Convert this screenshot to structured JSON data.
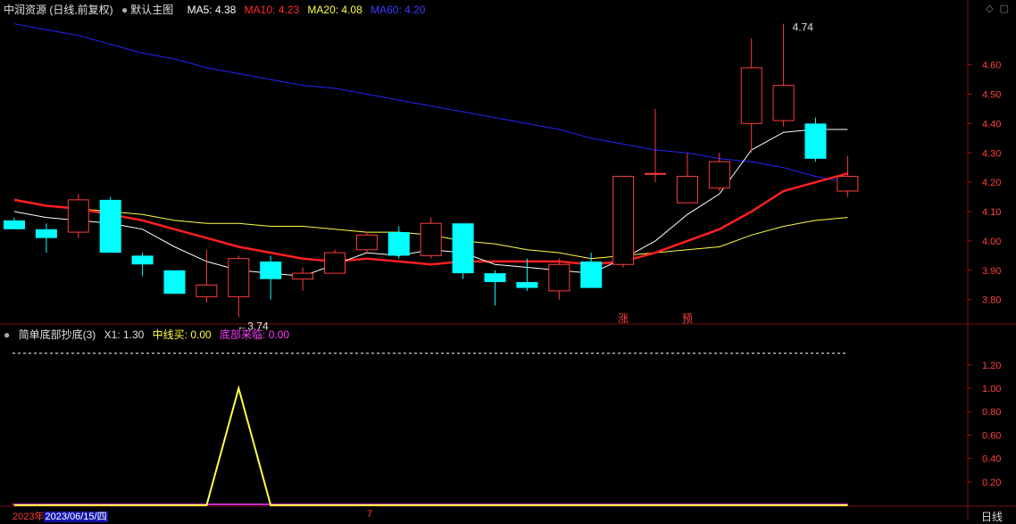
{
  "header": {
    "stock": "中润资源 (日线,前复权)",
    "template": "默认主图",
    "ma5": "MA5: 4.38",
    "ma10": "MA10: 4.23",
    "ma20": "MA20: 4.08",
    "ma60": "MA60: 4.20"
  },
  "indicator_header": {
    "name": "简单底部抄底(3)",
    "x1": "X1: 1.30",
    "zhongxian": "中线买: 0.00",
    "dibu": "底部来临: 0.00"
  },
  "footer": {
    "year": "2023年",
    "date": "2023/06/15/四",
    "mark": "7",
    "period": "日线"
  },
  "colors": {
    "up": "#ff3c3c",
    "down": "#00ffff",
    "ma5": "#ffffff",
    "ma10": "#ff2020",
    "ma20": "#ffff44",
    "ma60": "#2424ff"
  },
  "chart_data": [
    {
      "type": "candlestick",
      "yticks": [
        3.8,
        3.9,
        4.0,
        4.1,
        4.2,
        4.3,
        4.4,
        4.5,
        4.6
      ],
      "ylim": [
        3.72,
        4.76
      ],
      "candles": [
        {
          "o": 4.07,
          "h": 4.08,
          "l": 4.04,
          "c": 4.04
        },
        {
          "o": 4.04,
          "h": 4.06,
          "l": 3.96,
          "c": 4.01
        },
        {
          "o": 4.03,
          "h": 4.16,
          "l": 4.01,
          "c": 4.14
        },
        {
          "o": 4.14,
          "h": 4.15,
          "l": 3.96,
          "c": 3.96
        },
        {
          "o": 3.95,
          "h": 3.96,
          "l": 3.88,
          "c": 3.92
        },
        {
          "o": 3.9,
          "h": 3.9,
          "l": 3.82,
          "c": 3.82
        },
        {
          "o": 3.81,
          "h": 3.97,
          "l": 3.79,
          "c": 3.85
        },
        {
          "o": 3.81,
          "h": 3.95,
          "l": 3.74,
          "c": 3.94
        },
        {
          "o": 3.93,
          "h": 3.95,
          "l": 3.8,
          "c": 3.87
        },
        {
          "o": 3.87,
          "h": 3.91,
          "l": 3.83,
          "c": 3.89
        },
        {
          "o": 3.89,
          "h": 3.97,
          "l": 3.89,
          "c": 3.96
        },
        {
          "o": 3.97,
          "h": 4.03,
          "l": 3.96,
          "c": 4.02
        },
        {
          "o": 4.03,
          "h": 4.05,
          "l": 3.94,
          "c": 3.95
        },
        {
          "o": 3.95,
          "h": 4.08,
          "l": 3.94,
          "c": 4.06
        },
        {
          "o": 4.06,
          "h": 4.06,
          "l": 3.87,
          "c": 3.89
        },
        {
          "o": 3.89,
          "h": 3.9,
          "l": 3.78,
          "c": 3.86
        },
        {
          "o": 3.86,
          "h": 3.94,
          "l": 3.83,
          "c": 3.84
        },
        {
          "o": 3.83,
          "h": 3.94,
          "l": 3.8,
          "c": 3.92
        },
        {
          "o": 3.93,
          "h": 3.96,
          "l": 3.84,
          "c": 3.84
        },
        {
          "o": 3.92,
          "h": 4.22,
          "l": 3.91,
          "c": 4.22
        },
        {
          "o": 4.23,
          "h": 4.45,
          "l": 4.2,
          "c": 4.23
        },
        {
          "o": 4.13,
          "h": 4.3,
          "l": 4.13,
          "c": 4.22
        },
        {
          "o": 4.18,
          "h": 4.3,
          "l": 4.17,
          "c": 4.27
        },
        {
          "o": 4.4,
          "h": 4.69,
          "l": 4.3,
          "c": 4.59
        },
        {
          "o": 4.41,
          "h": 4.74,
          "l": 4.39,
          "c": 4.53
        },
        {
          "o": 4.4,
          "h": 4.42,
          "l": 4.27,
          "c": 4.28
        },
        {
          "o": 4.17,
          "h": 4.29,
          "l": 4.15,
          "c": 4.22
        }
      ],
      "ma5": [
        4.1,
        4.08,
        4.07,
        4.06,
        4.04,
        3.98,
        3.93,
        3.9,
        3.89,
        3.88,
        3.92,
        3.96,
        3.95,
        3.97,
        3.96,
        3.92,
        3.91,
        3.9,
        3.89,
        3.94,
        4.0,
        4.09,
        4.16,
        4.31,
        4.37,
        4.38,
        4.38
      ],
      "ma10": [
        4.14,
        4.12,
        4.11,
        4.09,
        4.07,
        4.04,
        4.01,
        3.98,
        3.96,
        3.94,
        3.93,
        3.94,
        3.93,
        3.92,
        3.93,
        3.93,
        3.93,
        3.93,
        3.92,
        3.93,
        3.96,
        4.0,
        4.04,
        4.1,
        4.17,
        4.2,
        4.23
      ],
      "ma20": [
        4.14,
        4.12,
        4.11,
        4.1,
        4.09,
        4.07,
        4.06,
        4.06,
        4.05,
        4.05,
        4.04,
        4.03,
        4.03,
        4.02,
        4.0,
        3.99,
        3.97,
        3.96,
        3.94,
        3.95,
        3.96,
        3.97,
        3.98,
        4.02,
        4.05,
        4.07,
        4.08
      ],
      "ma60": [
        4.74,
        4.72,
        4.7,
        4.67,
        4.64,
        4.62,
        4.59,
        4.57,
        4.55,
        4.53,
        4.52,
        4.5,
        4.48,
        4.46,
        4.44,
        4.42,
        4.4,
        4.38,
        4.35,
        4.33,
        4.31,
        4.3,
        4.28,
        4.27,
        4.25,
        4.22,
        4.2
      ],
      "annotations": [
        {
          "label": "←3.74",
          "candle": 7,
          "price": 3.74
        },
        {
          "label": "4.74",
          "candle": 24,
          "price": 4.74
        }
      ],
      "markers": [
        {
          "label": "涨",
          "candle": 19
        },
        {
          "label": "预",
          "candle": 21
        }
      ]
    },
    {
      "type": "line",
      "yticks": [
        0.2,
        0.4,
        0.6,
        0.8,
        1.0,
        1.2
      ],
      "ylim": [
        0,
        1.42
      ],
      "x1_level": 1.3,
      "values": [
        0,
        0,
        0,
        0,
        0,
        0,
        0,
        1,
        0,
        0,
        0,
        0,
        0,
        0,
        0,
        0,
        0,
        0,
        0,
        0,
        0,
        0,
        0,
        0,
        0,
        0,
        0
      ]
    }
  ]
}
